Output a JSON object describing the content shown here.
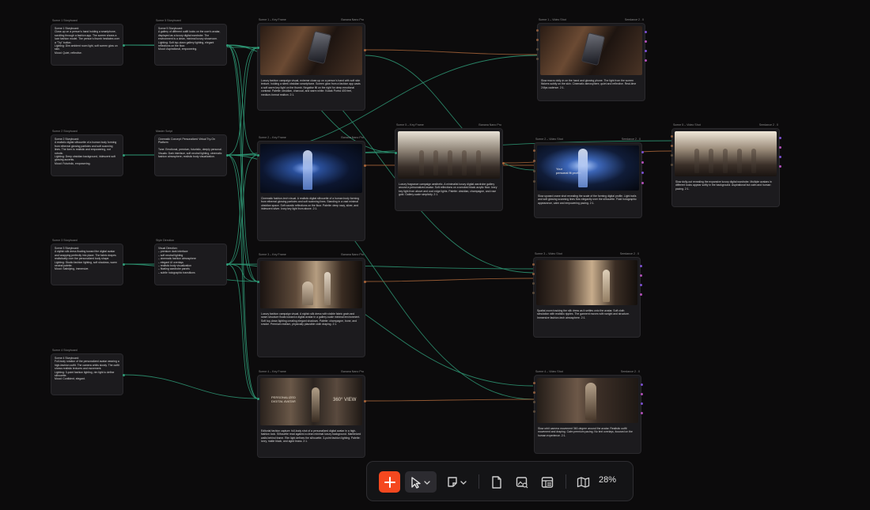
{
  "colors": {
    "background": "#0c0b0c",
    "card": "#1c1b1e",
    "edge_green": "#2f9a77",
    "edge_orange": "#a8653a",
    "accent": "#f5481f"
  },
  "storyboards": [
    {
      "label": "Scene 1 Storyboard",
      "text": "Scene 1 Storyboard:\nClose-up on a person's hand holding a smartphone, scrolling through a fashion app. The screen shows a luxe fashion model. The person's thumb hesitates over a \"Try\" button.\nLighting: Dim ambient room light, soft screen glow on skin.\nMood: Quiet, reflective."
    },
    {
      "label": "Scene 2 Storyboard",
      "text": "Scene 2 Storyboard:\nA realistic digital silhouette of a human body forming from ethereal glowing particles and soft scanning lines. The form is realistic and empowering, not robotic.\nLighting: Deep obsidian background, iridescent soft glowing accents.\nMood: Futuristic, empowering."
    },
    {
      "label": "Scene 3 Storyboard",
      "text": "Scene 3 Storyboard:\nA stylish silk dress floating toward the digital avatar and wrapping perfectly into place. The fabric drapes realistically over the personalized body shape.\nLighting: Studio fashion lighting, soft shadows, warm neutral palette.\nMood: Satisfying, immersive."
    },
    {
      "label": "Scene 4 Storyboard",
      "text": "Scene 4 Storyboard:\nFull-body rotation of the personalized avatar wearing a high-fashion outfit. The camera orbits slowly. The outfit shows realistic textures and movement.\nLighting: 3-point fashion lighting, rim light to define silhouette.\nMood: Confident, elegant."
    }
  ],
  "prompts": [
    {
      "label": "Scene 5 Storyboard",
      "text": "Scene 5 Storyboard:\nA gallery of different outfit looks on the user's avatar, displayed as a luxury digital wardrobe. The environment is a clean, minimal luxury showroom.\nLighting: Soft top-down gallery lighting, elegant reflections on the floor.\nMood: Aspirational, empowering."
    },
    {
      "label": "Master Script",
      "text": "Cinematic Concept: Personalized Virtual Try-On Platform\n\nTone: Emotional, premium, futuristic, deeply personal.\nVisuals: Dark interface, soft neutral lighting, cinematic fashion atmosphere, realistic body visualization."
    },
    {
      "label": "Style Direction",
      "text": "Visual Direction:\n– premium dark interface\n– soft neutral lighting\n– cinematic fashion atmosphere\n– elegant UI overlays\n– realistic body visualization\n– floating wardrobe panels\n– subtle holographic transitions"
    }
  ],
  "keyframes": [
    {
      "label": "Scene 1 – Key Frame",
      "meta": "Banana  Nano  Pro",
      "text": "Luxury fashion campaign visual, extreme close-up on a person's hand with soft skin texture, holding a sleek obsidian smartphone. Screen glow from a fashion app casts a soft warm key light on the thumb. Negative fill on the right for deep emotional contrast. Palette: obsidian, charcoal, and warm white. Kodak Portra 400 feel, medium-format realism. 2:1."
    },
    {
      "label": "Scene 2 – Key Frame",
      "meta": "Banana  Nano  Pro",
      "text": "Cinematic fashion-tech visual. A realistic digital silhouette of a human body forming from ethereal glowing particles and soft scanning lines. Standing in a vast minimal obsidian space. Soft caustic reflections on the floor. Palette: deep navy, silver, and iridescent silver. Ivory key light from above. 2:1."
    },
    {
      "label": "Scene 3 – Key Frame",
      "meta": "Banana  Nano  Pro",
      "text": "Luxury fashion campaign visual. A stylish silk dress with visible fabric grain and seam structure floats toward a digital avatar in a gallery-scale minimal environment. Soft top-down lighting creating elegant shadows. Palette: champagne, bone, and smoke. Premium realism, physically plausible cloth draping. 2:1."
    },
    {
      "label": "Scene 4 – Key Frame",
      "meta": "Banana  Nano  Pro",
      "text": "Editorial fashion capture: full-body shot of a personalized digital avatar in a high-fashion look. Silhouette read against a clean minimal luxury background. Marbleized walls behind frame. Rim light defines the silhouette. 3-point fashion lighting. Palette: ivory, matte black, and aged brass. 2:1."
    },
    {
      "label": "Scene 5 – Key Frame",
      "meta": "Banana  Nano  Pro",
      "text": "Luxury fragrance campaign aesthetic. A minimalist luxury digital wardrobe gallery around a personalized avatar. Soft reflections on a smoked black acrylic floor. Ivory key light from above and cool edge lights. Palette: obsidian, champagne, and rose gold. Gallery-scale simplicity. 2:1."
    }
  ],
  "videos": [
    {
      "label": "Scene 1 – Video Shot",
      "meta": "Seedance  2 . 0",
      "text": "Slow macro dolly-in on the hand and glowing phone. The light from the screen flickers subtly on the skin. Cinematic atmosphere, quiet and reflective. Real-time 24fps cadence. 2:1."
    },
    {
      "label": "Scene 2 – Video Shot",
      "meta": "Seedance  2 . 0",
      "text": "Slow upward crane shot revealing the scale of the forming digital profile. Light trails and soft glowing scanning lines flow elegantly over the silhouette. Fluid holographic appearance, calm and empowering pacing. 2:1."
    },
    {
      "label": "Scene 3 – Video Shot",
      "meta": "Seedance  2 . 0",
      "text": "Spatial zoom tracking the silk dress as it settles onto the avatar. Soft cloth simulation with realistic ripples. The garment moves with weight and structure. Immersive fashion-tech atmosphere. 2:1."
    },
    {
      "label": "Scene 4 – Video Shot",
      "meta": "Seedance  2 . 0",
      "text": "Slow orbit camera movement 360-degree around the avatar. Realistic outfit movement and draping. Calm premium pacing. No text overlays, focused on the human experience. 2:1."
    },
    {
      "label": "Scene 5 – Video Shot",
      "meta": "Seedance  2 . 0",
      "text": "Slow dolly-out revealing the expansive luxury digital wardrobe. Multiple avatars in different looks appear softly in the background. Aspirational but calm and human pacing. 2:1."
    }
  ],
  "overlays": {
    "scene2_video_caption": "Your\npersonal fit profile.",
    "scene4_kf_left": "PERSONALIZED\nDIGITAL AVATAR",
    "scene4_kf_right": "360° VIEW"
  },
  "toolbar": {
    "add": "plus-icon",
    "select": "cursor-icon",
    "note": "sticky-note-icon",
    "document": "document-icon",
    "image_search": "image-search-icon",
    "layout": "layout-icon",
    "map": "map-icon",
    "zoom": "28%"
  }
}
